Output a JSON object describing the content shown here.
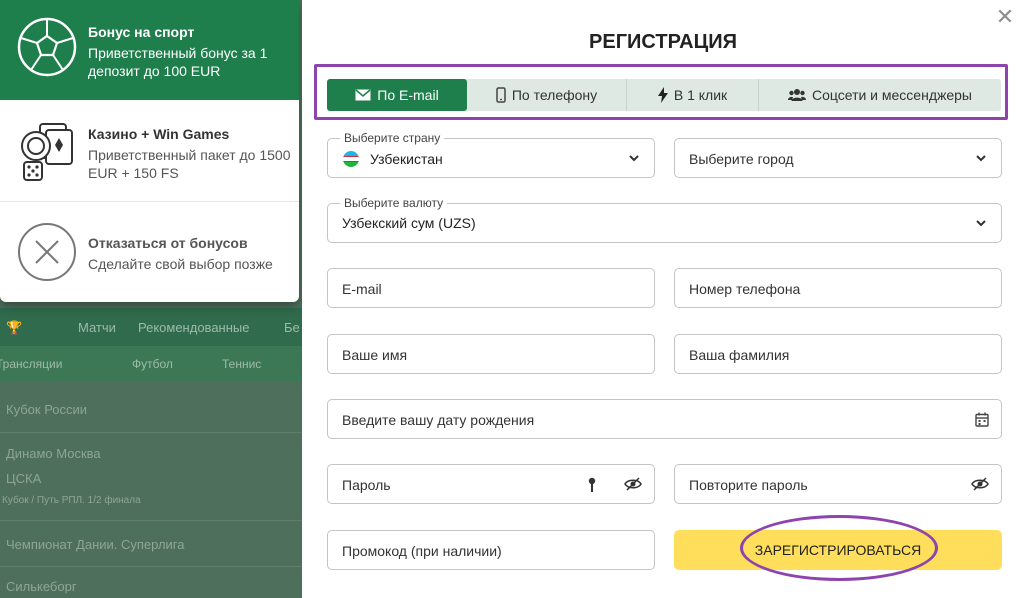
{
  "background": {
    "nav": [
      "Матчи",
      "Рекомендованные",
      "Бе"
    ],
    "subnav": [
      "Трансляции",
      "Футбол",
      "Теннис"
    ],
    "rows": [
      "Кубок России",
      "Динамо Москва",
      "ЦСКА",
      "Кубок / Путь РПЛ. 1/2 финала",
      "Чемпионат Дании. Суперлига",
      "Силькеборг"
    ]
  },
  "bonus": {
    "items": [
      {
        "title": "Бонус на спорт",
        "desc": "Приветственный бонус за 1 депозит до 100 EUR",
        "icon": "soccer-ball-icon"
      },
      {
        "title": "Казино + Win Games",
        "desc": "Приветственный пакет до 1500 EUR + 150 FS",
        "icon": "casino-chips-icon"
      },
      {
        "title": "Отказаться от бонусов",
        "desc": "Сделайте свой выбор позже",
        "icon": "decline-x-icon"
      }
    ]
  },
  "modal": {
    "title": "РЕГИСТРАЦИЯ",
    "tabs": [
      {
        "label": "По E-mail",
        "icon": "envelope-icon"
      },
      {
        "label": "По телефону",
        "icon": "phone-icon"
      },
      {
        "label": "В 1 клик",
        "icon": "lightning-icon"
      },
      {
        "label": "Соцсети и мессенджеры",
        "icon": "users-icon"
      }
    ],
    "country": {
      "label": "Выберите страну",
      "value": "Узбекистан"
    },
    "city": {
      "placeholder": "Выберите город"
    },
    "currency": {
      "label": "Выберите валюту",
      "value": "Узбекский сум (UZS)"
    },
    "email": {
      "placeholder": "E-mail"
    },
    "phone": {
      "placeholder": "Номер телефона"
    },
    "first_name": {
      "placeholder": "Ваше имя"
    },
    "last_name": {
      "placeholder": "Ваша фамилия"
    },
    "birth_date": {
      "placeholder": "Введите вашу дату рождения"
    },
    "password": {
      "placeholder": "Пароль"
    },
    "password_repeat": {
      "placeholder": "Повторите пароль"
    },
    "promo": {
      "placeholder": "Промокод (при наличии)"
    },
    "register_label": "ЗАРЕГИСТРИРОВАТЬСЯ"
  },
  "colors": {
    "brand_green": "#1e7f4c",
    "accent_yellow": "#fede5a",
    "highlight_purple": "#8e44ad"
  }
}
